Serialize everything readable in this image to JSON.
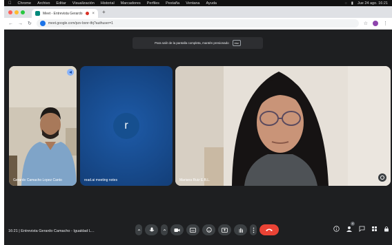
{
  "menubar": {
    "items": [
      "Chrome",
      "Archivo",
      "Editar",
      "Visualización",
      "Historial",
      "Marcadores",
      "Perfiles",
      "Pestaña",
      "Ventana",
      "Ayuda"
    ],
    "clock": "Jue 24 ago. 16:21"
  },
  "browser": {
    "tab_title": "Meet - Entrevista Gerardo",
    "url": "meet.google.com/pzv-bxnr-tfq?authuser=1",
    "colors": {
      "close": "#ff5f57",
      "minimize": "#febc2e",
      "maximize": "#28c840"
    }
  },
  "notice": {
    "text": "Para salir de la pantalla completa, mantén presionado",
    "key": "esc"
  },
  "tiles": {
    "left_label": "Gerardo Camacho Lopez Canto",
    "middle_label": "read.ai meeting notes",
    "middle_avatar": "r",
    "right_label": "Mariana Ruiz E.B.L."
  },
  "bottom": {
    "meeting_info": "16:21  |  Entrevista Gerardo Camacho - Igualdad L...",
    "participant_badge": "4"
  },
  "accent_colors": {
    "hangup": "#ea4335",
    "background": "#1e1f21",
    "avatar_tile": "#174a8c"
  }
}
